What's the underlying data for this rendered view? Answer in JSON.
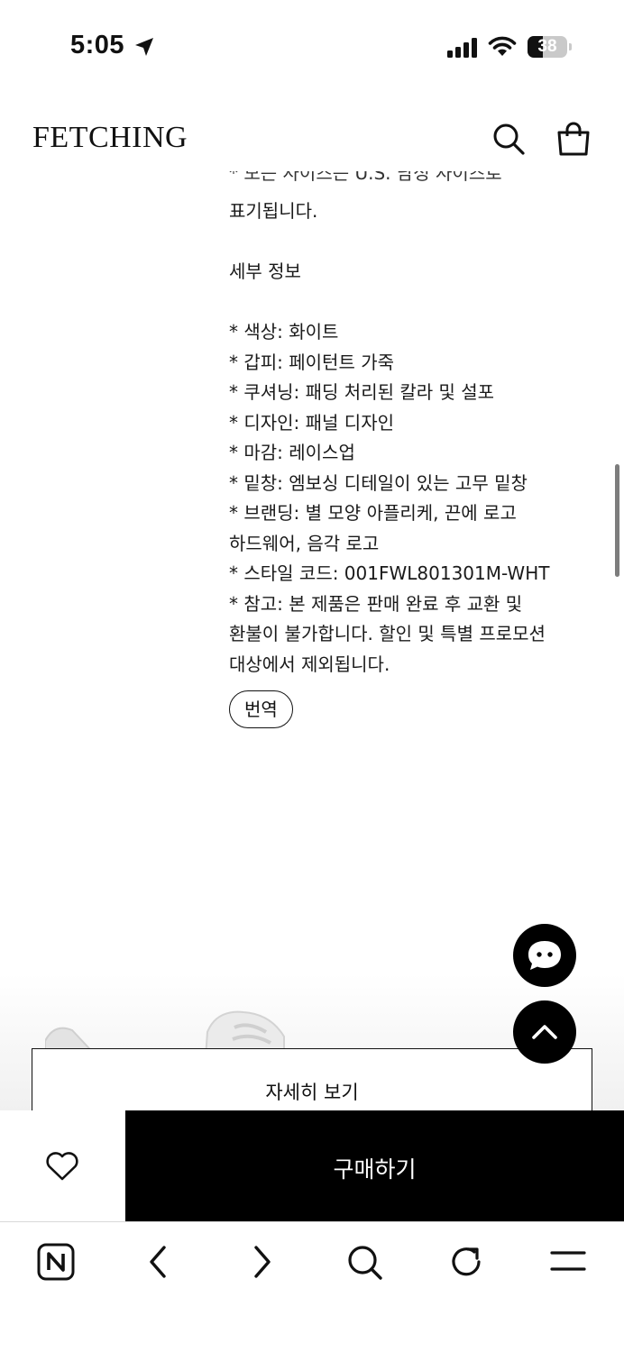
{
  "status_bar": {
    "time": "5:05",
    "battery_level": "38",
    "battery_fraction": 0.38
  },
  "header": {
    "logo": "FETCHING"
  },
  "description": {
    "clipped_line": "* 모든 사이즈는 U.S. 남성 사이즈로",
    "size_note_end": "표기됩니다.",
    "section_title": "세부 정보",
    "lines": [
      "* 색상: 화이트",
      "* 갑피: 페이턴트 가죽",
      "* 쿠셔닝: 패딩 처리된 칼라 및 설포",
      "* 디자인: 패널 디자인",
      "* 마감: 레이스업",
      "* 밑창: 엠보싱 디테일이 있는 고무 밑창",
      "* 브랜딩: 별 모양 아플리케, 끈에 로고",
      "하드웨어, 음각 로고",
      "* 스타일 코드: 001FWL801301M-WHT",
      "* 참고: 본 제품은 판매 완료 후 교환 및",
      "환불이 불가합니다. 할인 및 특별 프로모션",
      "대상에서 제외됩니다."
    ],
    "translate_label": "번역"
  },
  "details_button": {
    "label": "자세히 보기"
  },
  "purchase": {
    "buy_label": "구매하기"
  },
  "icons": {
    "location": "location-arrow-icon",
    "search": "search-icon",
    "bag": "shopping-bag-icon",
    "chat": "chat-bubble-icon",
    "scroll_top": "chevron-up-icon",
    "heart": "heart-icon",
    "naver": "naver-n-icon",
    "back": "chevron-left-icon",
    "forward": "chevron-right-icon",
    "browser_search": "search-icon",
    "reload": "reload-icon",
    "menu": "menu-icon"
  },
  "colors": {
    "primary": "#000000",
    "background": "#ffffff",
    "text": "#1a1a1a"
  }
}
